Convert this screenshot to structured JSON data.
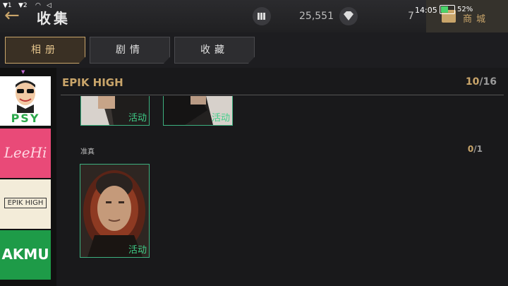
{
  "status": {
    "sig1": "1",
    "sig2": "2",
    "time": "14:05",
    "battery_pct": "52%",
    "battery_level": 0.52
  },
  "header": {
    "title": "收集",
    "resource1_value": "25,551",
    "resource2_value": "7",
    "shop_label": "商城"
  },
  "tabs": [
    {
      "label": "相册",
      "active": true
    },
    {
      "label": "剧情",
      "active": false
    },
    {
      "label": "收藏",
      "active": false
    }
  ],
  "sidebar": {
    "artists": [
      {
        "name": "PSY",
        "bg": "#ffffff",
        "fg": "#2aa84a"
      },
      {
        "name": "LeeHi",
        "bg": "#e94a78",
        "fg": "#ffd6e2"
      },
      {
        "name": "EPIK HIGH",
        "bg": "#f3ecd9",
        "fg": "#333333"
      },
      {
        "name": "AKMU",
        "bg": "#1e9b48",
        "fg": "#ffffff"
      }
    ]
  },
  "group": {
    "title": "EPIK HIGH",
    "count_current": "10",
    "count_total": "/16"
  },
  "cards_top": [
    {
      "badge": "活动"
    },
    {
      "badge": "活动"
    }
  ],
  "subsection": {
    "label": "准真",
    "count_current": "0",
    "count_total": "/1"
  },
  "card_main": {
    "badge": "活动"
  },
  "colors": {
    "accent": "#c9a56a",
    "badge": "#3ecf89",
    "card_border": "#3db07f"
  }
}
